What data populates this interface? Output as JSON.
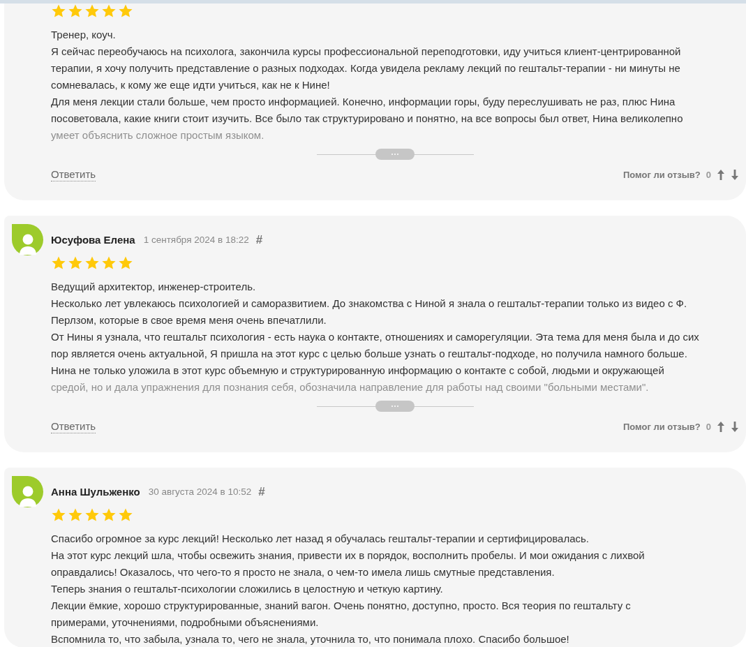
{
  "reviews": [
    {
      "stars": 5,
      "paragraphs": [
        [
          "Тренер, коуч."
        ],
        [
          "Я сейчас переобучаюсь на психолога, закончила курсы профессиональной переподготовки, иду учиться клиент-центрированной",
          "терапии, я хочу получить представление о разных подходах. Когда увидела рекламу лекций по гештальт-терапии - ни минуты не",
          "сомневалась, к кому же еще идти учиться, как не к Нине!"
        ],
        [
          "Для меня лекции стали больше, чем просто информацией. Конечно, информации горы, буду переслушивать не раз, плюс Нина",
          "посоветовала, какие книги стоит изучить. Все было так структурировано и понятно, на все вопросы был ответ, Нина великолепно"
        ]
      ],
      "faded_text": "умеет объяснить сложное простым языком.",
      "reply_label": "Ответить",
      "helpful_label": "Помог ли отзыв?",
      "helpful_count": "0"
    },
    {
      "author": "Юсуфова Елена",
      "date": "1 сентября 2024 в 18:22",
      "anchor": "#",
      "stars": 5,
      "paragraphs": [
        [
          "Ведущий архитектор, инженер-строитель."
        ],
        [
          "Несколько лет увлекаюсь психологией и саморазвитием. До знакомства с Ниной я знала о гештальт-терапии только из видео с Ф.",
          "Перлзом, которые в свое время меня очень впечатлили."
        ],
        [
          "От Нины я узнала, что гештальт психология - есть наука о контакте, отношениях и саморегуляции. Эта тема для меня была и до сих",
          "пор является очень актуальной, Я пришла на этот курс с целью больше узнать о гештальт-подходе, но получила намного больше."
        ],
        [
          "Нина не только уложила в этот курс объемную и структурированную информацию о контакте с собой, людьми и окружающей"
        ]
      ],
      "faded_text": "средой, но и дала упражнения для познания себя, обозначила направление для работы над своими \"больными местами\".",
      "reply_label": "Ответить",
      "helpful_label": "Помог ли отзыв?",
      "helpful_count": "0"
    },
    {
      "author": "Анна Шульженко",
      "date": "30 августа 2024 в 10:52",
      "anchor": "#",
      "stars": 5,
      "paragraphs": [
        [
          "Спасибо огромное за курс лекций! Несколько лет назад я обучалась гештальт-терапии и сертифицировалась."
        ],
        [
          "На этот курс лекций шла, чтобы освежить знания, привести их в порядок, восполнить пробелы. И мои ожидания с лихвой",
          "оправдались! Оказалось, что чего-то я просто не знала, о чем-то имела лишь смутные представления."
        ],
        [
          "Теперь знания о гештальт-психологии сложились в целостную и четкую картину."
        ],
        [
          "Лекции ёмкие, хорошо структурированные, знаний вагон. Очень понятно, доступно, просто. Вся теория по гештальту с",
          "примерами, уточнениями, подробными объяснениями."
        ],
        [
          "Вспомнила то, что забыла, узнала то, чего не знала, уточнила то, что понимала плохо. Спасибо большое!"
        ]
      ]
    }
  ]
}
